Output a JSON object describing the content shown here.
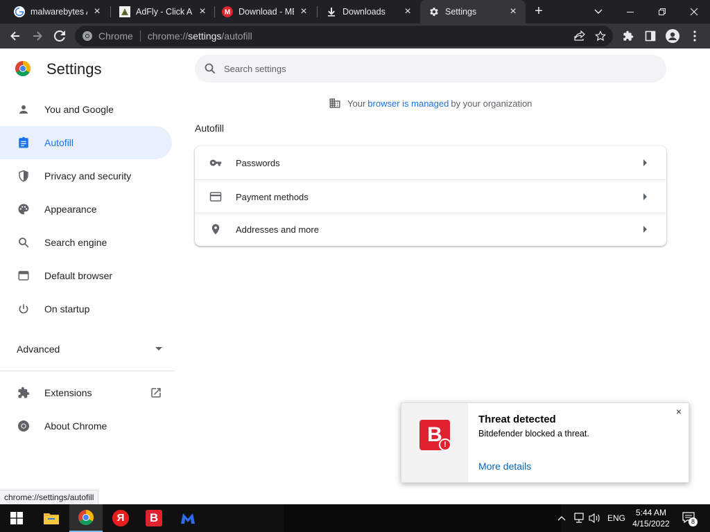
{
  "tabs": [
    {
      "title": "malwarebytes A",
      "favicon": "google-icon"
    },
    {
      "title": "AdFly - Click All",
      "favicon": "adfly-icon"
    },
    {
      "title": "Download - ME",
      "favicon": "mega-icon"
    },
    {
      "title": "Downloads",
      "favicon": "download-icon"
    },
    {
      "title": "Settings",
      "favicon": "gear-icon",
      "active": true
    }
  ],
  "omnibox": {
    "site": "Chrome",
    "url_scheme": "chrome://",
    "url_path": "settings",
    "url_rest": "/autofill"
  },
  "settings": {
    "title": "Settings",
    "search_placeholder": "Search settings",
    "managed": {
      "prefix": "Your",
      "link": "browser is managed",
      "suffix": "by your organization"
    },
    "nav": [
      {
        "label": "You and Google",
        "icon": "person-icon"
      },
      {
        "label": "Autofill",
        "icon": "autofill-icon",
        "active": true
      },
      {
        "label": "Privacy and security",
        "icon": "shield-icon"
      },
      {
        "label": "Appearance",
        "icon": "palette-icon"
      },
      {
        "label": "Search engine",
        "icon": "search-icon"
      },
      {
        "label": "Default browser",
        "icon": "browser-icon"
      },
      {
        "label": "On startup",
        "icon": "power-icon"
      }
    ],
    "advanced_label": "Advanced",
    "extensions_label": "Extensions",
    "about_label": "About Chrome",
    "section_title": "Autofill",
    "rows": [
      {
        "label": "Passwords",
        "icon": "key-icon"
      },
      {
        "label": "Payment methods",
        "icon": "credit-card-icon"
      },
      {
        "label": "Addresses and more",
        "icon": "location-pin-icon"
      }
    ]
  },
  "status_url": "chrome://settings/autofill",
  "toast": {
    "logo_letter": "B",
    "badge": "!",
    "title": "Threat detected",
    "message": "Bitdefender blocked a threat.",
    "link": "More details"
  },
  "taskbar": {
    "yandex_letter": "Я",
    "bitdefender_letter": "B",
    "language": "ENG",
    "time": "5:44 AM",
    "date": "4/15/2022",
    "notification_count": "8"
  },
  "colors": {
    "accent": "#1a73e8",
    "bitdefender_red": "#e0212e",
    "nav_active_bg": "#e8f0fe"
  }
}
